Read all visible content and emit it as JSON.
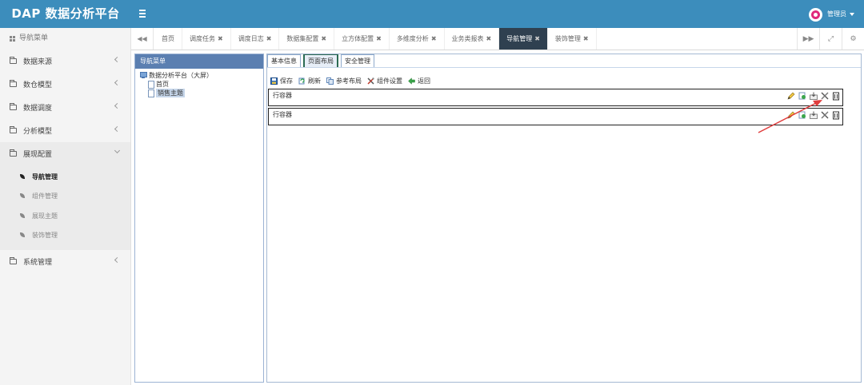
{
  "app": {
    "title": "DAP 数据分析平台"
  },
  "header": {
    "user_name": "管理员"
  },
  "sidebar": {
    "header_label": "导航菜单",
    "items": [
      {
        "label": "数据来源"
      },
      {
        "label": "数仓模型"
      },
      {
        "label": "数据调度"
      },
      {
        "label": "分析模型"
      },
      {
        "label": "展现配置",
        "open": true,
        "children": [
          {
            "label": "导航管理",
            "active": true
          },
          {
            "label": "组件管理"
          },
          {
            "label": "展现主题"
          },
          {
            "label": "装饰管理"
          }
        ]
      },
      {
        "label": "系统管理"
      }
    ]
  },
  "tabs": [
    {
      "label": "首页",
      "closable": false
    },
    {
      "label": "调度任务",
      "closable": true
    },
    {
      "label": "调度日志",
      "closable": true
    },
    {
      "label": "数据集配置",
      "closable": true
    },
    {
      "label": "立方体配置",
      "closable": true
    },
    {
      "label": "多维度分析",
      "closable": true
    },
    {
      "label": "业务类报表",
      "closable": true
    },
    {
      "label": "导航管理",
      "closable": true,
      "active": true
    },
    {
      "label": "装饰管理",
      "closable": true
    }
  ],
  "nav_panel": {
    "title": "导航菜单",
    "tree": {
      "root": "数据分析平台（大屏）",
      "children": [
        "首页",
        "销售主题"
      ],
      "selected": "销售主题"
    }
  },
  "main_panel": {
    "tabs": [
      {
        "label": "基本信息"
      },
      {
        "label": "页面布局",
        "active": true
      },
      {
        "label": "安全管理"
      }
    ],
    "toolbar": {
      "save": "保存",
      "refresh": "刷新",
      "reference_layout": "参考布局",
      "component_settings": "组件设置",
      "back": "返回"
    },
    "rows": [
      {
        "label": "行容器"
      },
      {
        "label": "行容器"
      }
    ]
  },
  "colors": {
    "header_bg": "#3c8dbc",
    "active_tab_bg": "#2f4050",
    "panel_title_bg": "#5b7fb1",
    "annotation_arrow": "#e03c3c"
  }
}
